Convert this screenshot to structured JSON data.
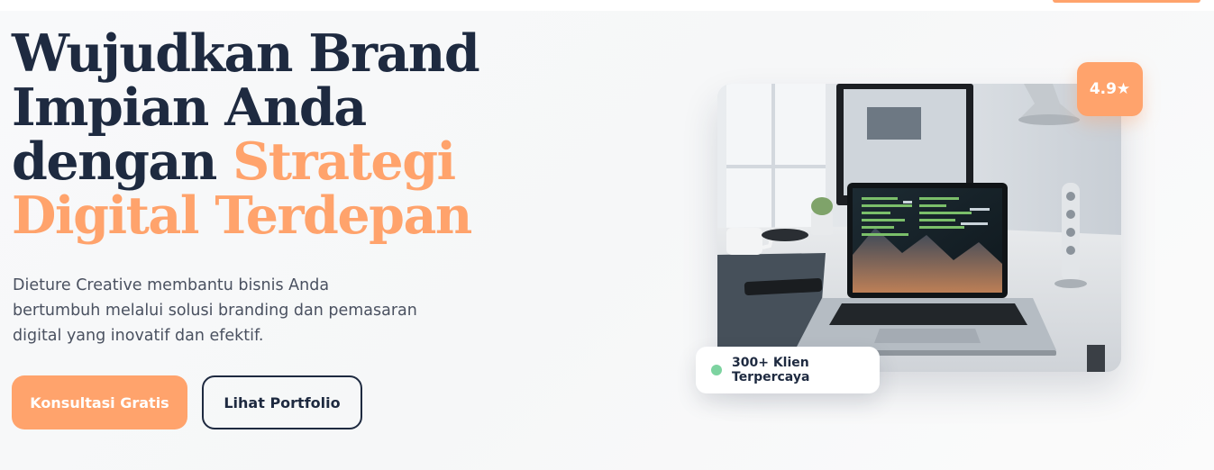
{
  "hero": {
    "headline_line1": "Wujudkan Brand",
    "headline_line2": "Impian Anda",
    "headline_line3_plain": "dengan ",
    "headline_line3_accent": "Strategi",
    "headline_line4_accent": "Digital Terdepan",
    "description": "Dieture Creative membantu bisnis Anda bertumbuh melalui solusi branding dan pemasaran digital yang inovatif dan efektif.",
    "primary_button": "Konsultasi Gratis",
    "secondary_button": "Lihat Portfolio"
  },
  "visual": {
    "rating_badge": "4.9★",
    "trust_label": "300+ Klien Terpercaya"
  },
  "colors": {
    "accent": "#ffa36c",
    "navy": "#1e2a40",
    "text_muted": "#4a5160",
    "status_green": "#7dd3a0"
  }
}
